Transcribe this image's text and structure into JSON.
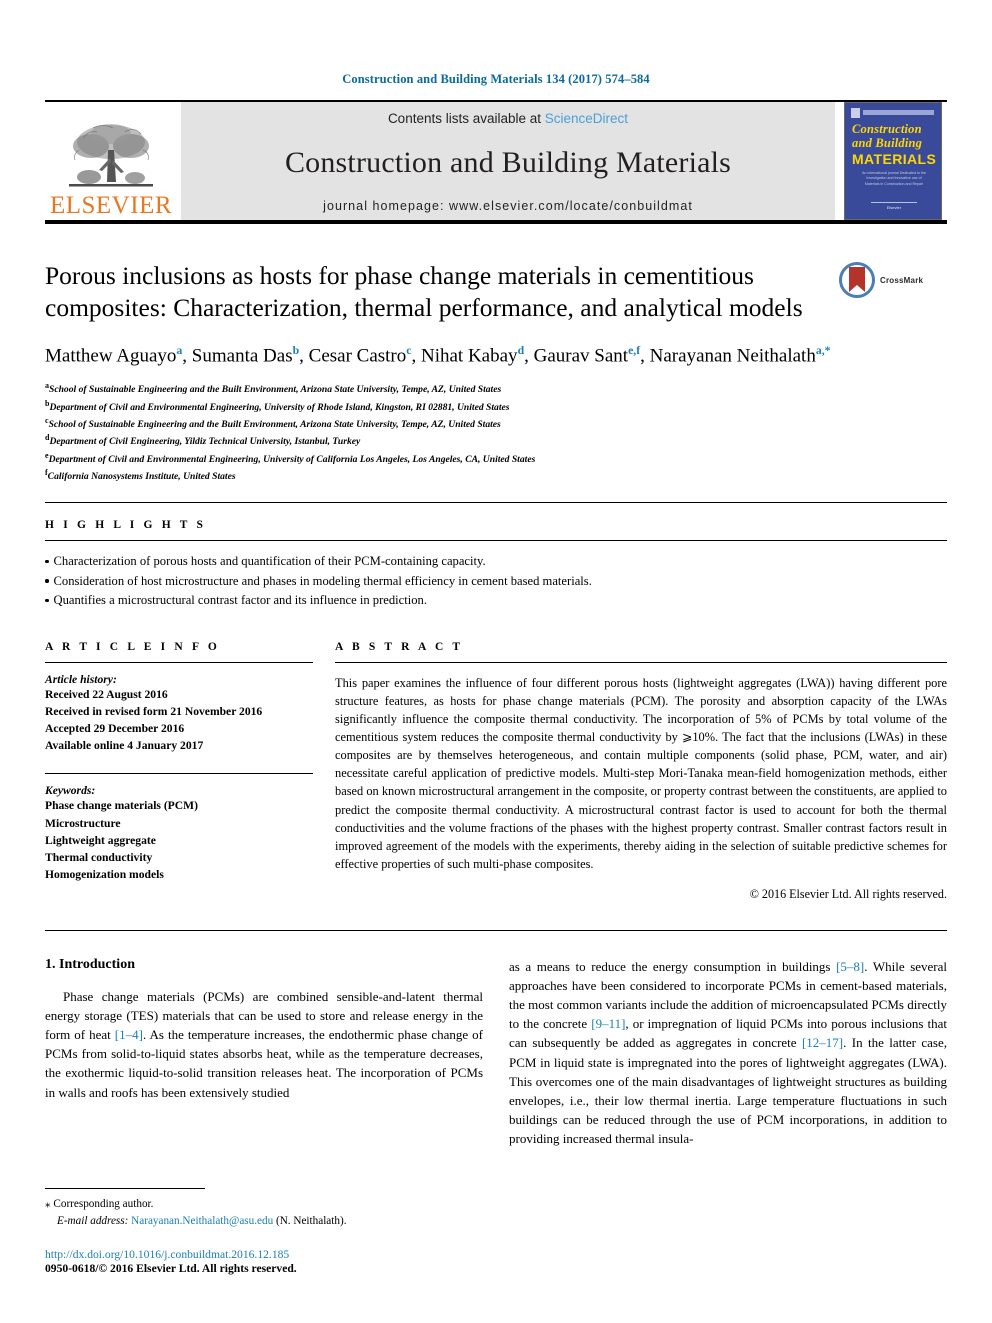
{
  "running_head": "Construction and Building Materials 134 (2017) 574–584",
  "masthead": {
    "publisher_logo_text": "ELSEVIER",
    "contents_prefix": "Contents lists available at ",
    "contents_link": "ScienceDirect",
    "journal_title": "Construction and Building Materials",
    "homepage_line": "journal homepage: www.elsevier.com/locate/conbuildmat",
    "cover": {
      "line1": "Construction",
      "line2": "and Building",
      "line3": "MATERIALS",
      "blurb": "An international journal Dedicated to the Investigation and Innovative use of Materials in Construction and Repair",
      "footer": "Elsevier"
    }
  },
  "title": "Porous inclusions as hosts for phase change materials in cementitious composites: Characterization, thermal performance, and analytical models",
  "crossmark_label": "CrossMark",
  "authors": [
    {
      "name": "Matthew Aguayo",
      "sup": "a"
    },
    {
      "name": "Sumanta Das",
      "sup": "b"
    },
    {
      "name": "Cesar Castro",
      "sup": "c"
    },
    {
      "name": "Nihat Kabay",
      "sup": "d"
    },
    {
      "name": "Gaurav Sant",
      "sup": "e,f"
    },
    {
      "name": "Narayanan Neithalath",
      "sup": "a,*"
    }
  ],
  "affiliations": [
    {
      "mark": "a",
      "text": "School of Sustainable Engineering and the Built Environment, Arizona State University, Tempe, AZ, United States"
    },
    {
      "mark": "b",
      "text": "Department of Civil and Environmental Engineering, University of Rhode Island, Kingston, RI 02881, United States"
    },
    {
      "mark": "c",
      "text": "School of Sustainable Engineering and the Built Environment, Arizona State University, Tempe, AZ, United States"
    },
    {
      "mark": "d",
      "text": "Department of Civil Engineering, Yildiz Technical University, Istanbul, Turkey"
    },
    {
      "mark": "e",
      "text": "Department of Civil and Environmental Engineering, University of California Los Angeles, Los Angeles, CA, United States"
    },
    {
      "mark": "f",
      "text": "California Nanosystems Institute, United States"
    }
  ],
  "highlights": {
    "heading": "H I G H L I G H T S",
    "items": [
      "Characterization of porous hosts and quantification of their PCM-containing capacity.",
      "Consideration of host microstructure and phases in modeling thermal efficiency in cement based materials.",
      "Quantifies a microstructural contrast factor and its influence in prediction."
    ]
  },
  "article_info": {
    "heading": "A R T I C L E   I N F O",
    "history_label": "Article history:",
    "history": [
      "Received 22 August 2016",
      "Received in revised form 21 November 2016",
      "Accepted 29 December 2016",
      "Available online 4 January 2017"
    ],
    "keywords_label": "Keywords:",
    "keywords": [
      "Phase change materials (PCM)",
      "Microstructure",
      "Lightweight aggregate",
      "Thermal conductivity",
      "Homogenization models"
    ]
  },
  "abstract": {
    "heading": "A B S T R A C T",
    "text": "This paper examines the influence of four different porous hosts (lightweight aggregates (LWA)) having different pore structure features, as hosts for phase change materials (PCM). The porosity and absorption capacity of the LWAs significantly influence the composite thermal conductivity. The incorporation of 5% of PCMs by total volume of the cementitious system reduces the composite thermal conductivity by ⩾10%. The fact that the inclusions (LWAs) in these composites are by themselves heterogeneous, and contain multiple components (solid phase, PCM, water, and air) necessitate careful application of predictive models. Multi-step Mori-Tanaka mean-field homogenization methods, either based on known microstructural arrangement in the composite, or property contrast between the constituents, are applied to predict the composite thermal conductivity. A microstructural contrast factor is used to account for both the thermal conductivities and the volume fractions of the phases with the highest property contrast. Smaller contrast factors result in improved agreement of the models with the experiments, thereby aiding in the selection of suitable predictive schemes for effective properties of such multi-phase composites.",
    "copyright": "© 2016 Elsevier Ltd. All rights reserved."
  },
  "body": {
    "section_number_title": "1. Introduction",
    "left_paragraph": {
      "p1": "Phase change materials (PCMs) are combined sensible-and-latent thermal energy storage (TES) materials that can be used to store and release energy in the form of heat ",
      "ref1": "[1–4]",
      "p2": ". As the temperature increases, the endothermic phase change of PCMs from solid-to-liquid states absorbs heat, while as the temperature decreases, the exothermic liquid-to-solid transition releases heat. The incorporation of PCMs in walls and roofs has been extensively studied"
    },
    "right_paragraph": {
      "p1": "as a means to reduce the energy consumption in buildings ",
      "ref1": "[5–8]",
      "p2": ". While several approaches have been considered to incorporate PCMs in cement-based materials, the most common variants include the addition of microencapsulated PCMs directly to the concrete ",
      "ref2": "[9–11]",
      "p3": ", or impregnation of liquid PCMs into porous inclusions that can subsequently be added as aggregates in concrete ",
      "ref3": "[12–17]",
      "p4": ". In the latter case, PCM in liquid state is impregnated into the pores of lightweight aggregates (LWA). This overcomes one of the main disadvantages of lightweight structures as building envelopes, i.e., their low thermal inertia. Large temperature fluctuations in such buildings can be reduced through the use of PCM incorporations, in addition to providing increased thermal insula-"
    }
  },
  "footer": {
    "corresponding_mark": "⁎",
    "corresponding_text": "Corresponding author.",
    "email_label": "E-mail address:",
    "email": "Narayanan.Neithalath@asu.edu",
    "email_owner": "(N. Neithalath).",
    "doi": "http://dx.doi.org/10.1016/j.conbuildmat.2016.12.185",
    "issn_line": "0950-0618/© 2016 Elsevier Ltd. All rights reserved."
  },
  "colors": {
    "link": "#1a7fb5",
    "running_head": "#0b6a9c",
    "elsevier_orange": "#E87722",
    "masthead_bg": "#e3e3e3",
    "cover_blue": "#3a4a9a",
    "cover_yellow": "#ffd700",
    "crossmark_blue": "#3a6ea8",
    "crossmark_red": "#b5342a"
  }
}
